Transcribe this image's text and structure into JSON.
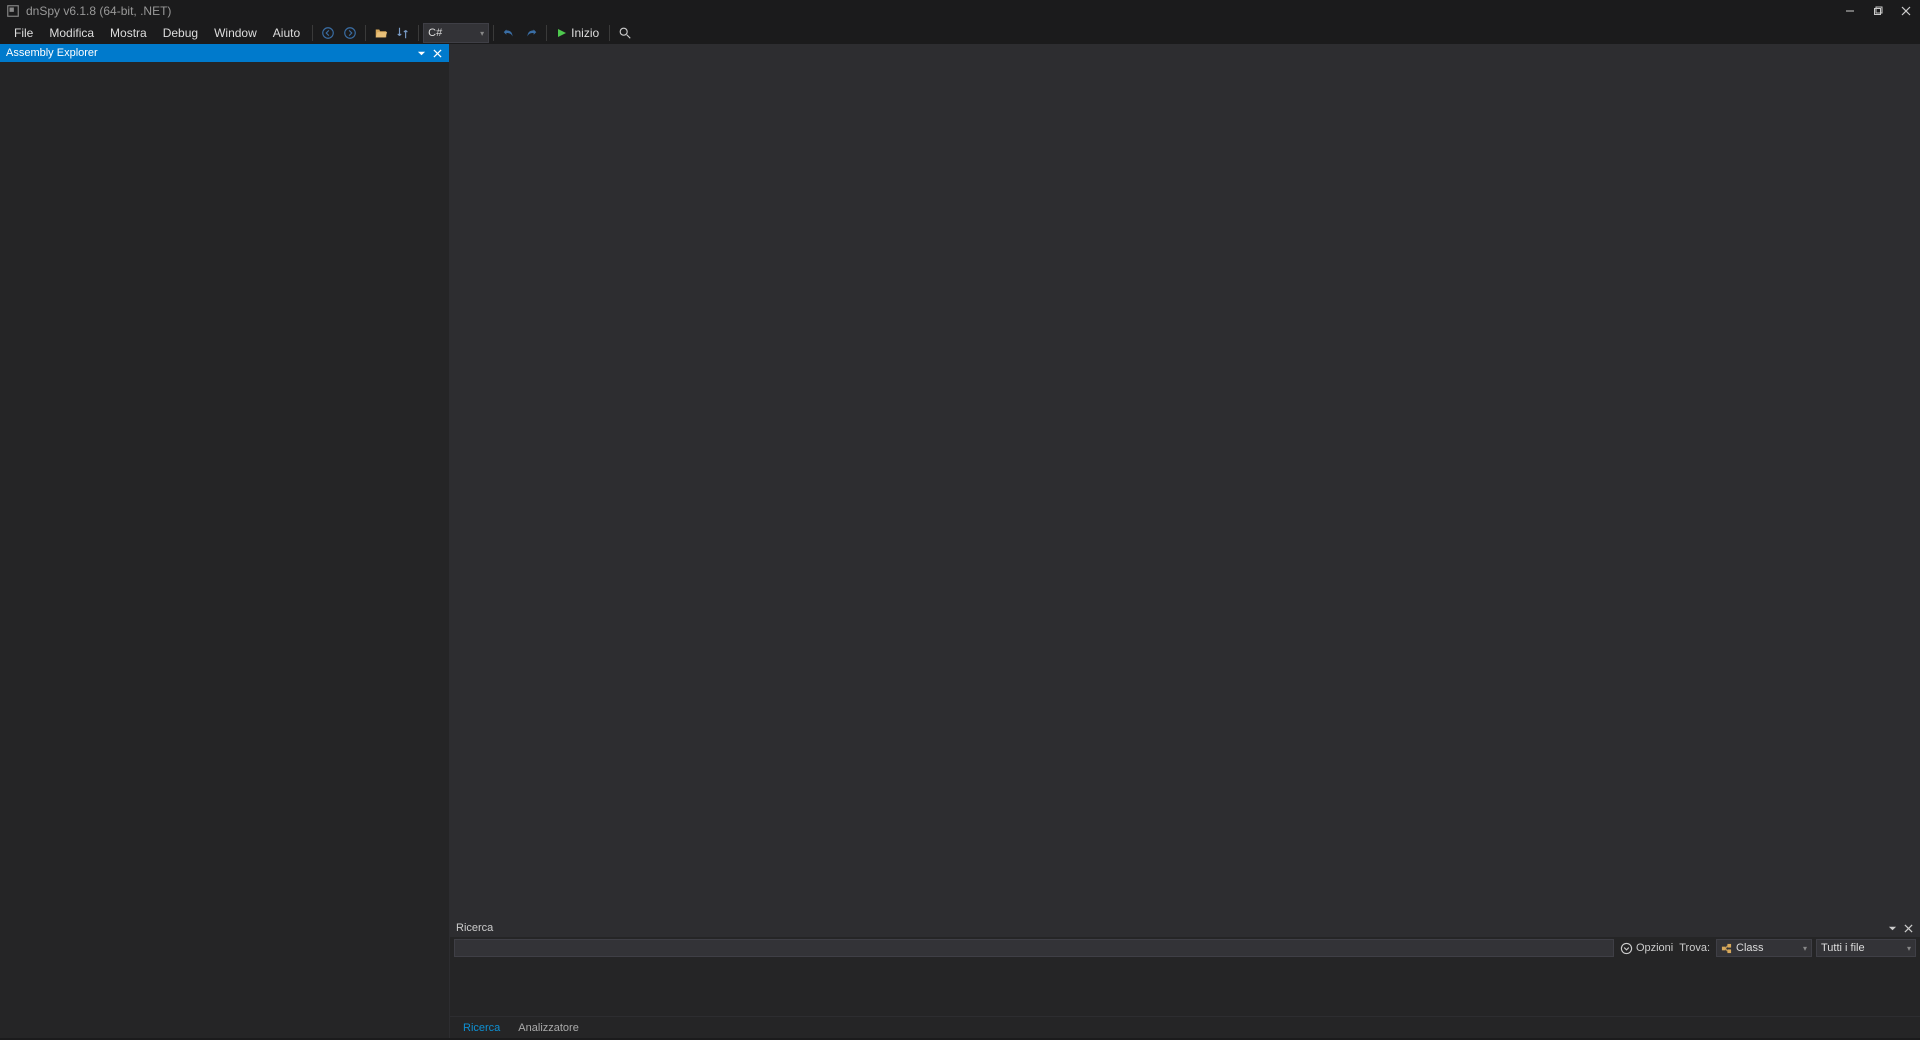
{
  "title": "dnSpy v6.1.8 (64-bit, .NET)",
  "menu": [
    "File",
    "Modifica",
    "Mostra",
    "Debug",
    "Window",
    "Aiuto"
  ],
  "toolbar": {
    "language": "C#",
    "start_label": "Inizio"
  },
  "left_panel": {
    "title": "Assembly Explorer"
  },
  "search_panel": {
    "title": "Ricerca",
    "options_label": "Opzioni",
    "find_label": "Trova:",
    "find_value": "Class",
    "scope_value": "Tutti i file"
  },
  "bottom_tabs": {
    "search": "Ricerca",
    "analyzer": "Analizzatore"
  }
}
